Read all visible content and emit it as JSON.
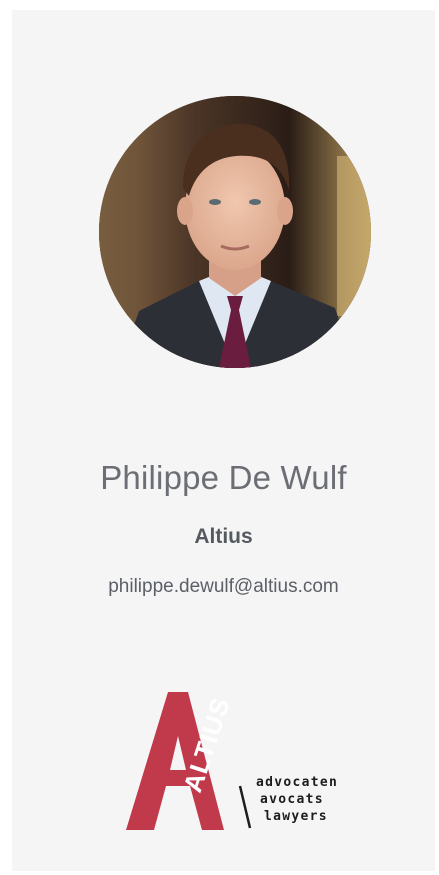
{
  "person": {
    "name": "Philippe De Wulf",
    "company": "Altius",
    "email": "philippe.dewulf@altius.com"
  },
  "logo": {
    "wordmark": "ALTIUS",
    "tagline": [
      "advocaten",
      "avocats",
      "lawyers"
    ],
    "brand_color": "#c13a4c"
  },
  "colors": {
    "card_background": "#f5f5f6",
    "name_text": "#6b6e74",
    "company_text": "#555a60"
  }
}
